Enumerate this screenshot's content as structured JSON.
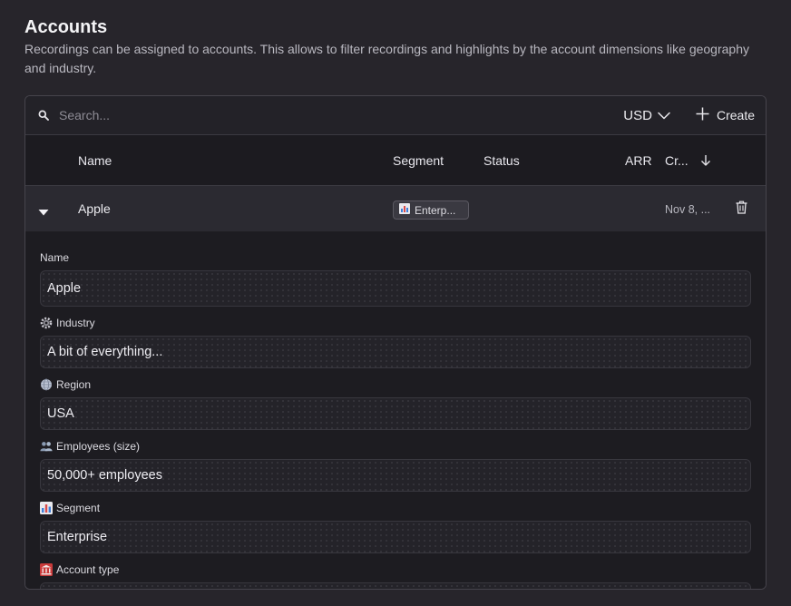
{
  "page": {
    "title": "Accounts",
    "description": "Recordings can be assigned to accounts. This allows to filter recordings and highlights by the account dimensions like geography and industry."
  },
  "toolbar": {
    "search_placeholder": "Search...",
    "currency": "USD",
    "create_label": "Create"
  },
  "table": {
    "columns": [
      "Name",
      "Segment",
      "Status",
      "ARR",
      "Cr..."
    ],
    "sort_indicator": "descending",
    "rows": [
      {
        "name": "Apple",
        "segment": "Enterp...",
        "segment_icon": "bar-chart-icon",
        "status": "",
        "arr": "",
        "created": "Nov 8, ..."
      }
    ]
  },
  "detail": {
    "fields": [
      {
        "label": "Name",
        "icon": "",
        "value": "Apple"
      },
      {
        "label": "Industry",
        "icon": "gear-icon",
        "value": "A bit of everything..."
      },
      {
        "label": "Region",
        "icon": "globe-icon",
        "value": "USA"
      },
      {
        "label": "Employees (size)",
        "icon": "people-icon",
        "value": "50,000+ employees"
      },
      {
        "label": "Segment",
        "icon": "bar-chart-icon",
        "value": "Enterprise"
      },
      {
        "label": "Account type",
        "icon": "bank-icon",
        "value": ""
      }
    ]
  },
  "colors": {
    "background": "#27252b",
    "card": "#1f1e23",
    "row_expanded": "#2b2a31",
    "border": "#46444c",
    "text": "#ececf0",
    "muted": "#b9b8c0"
  }
}
